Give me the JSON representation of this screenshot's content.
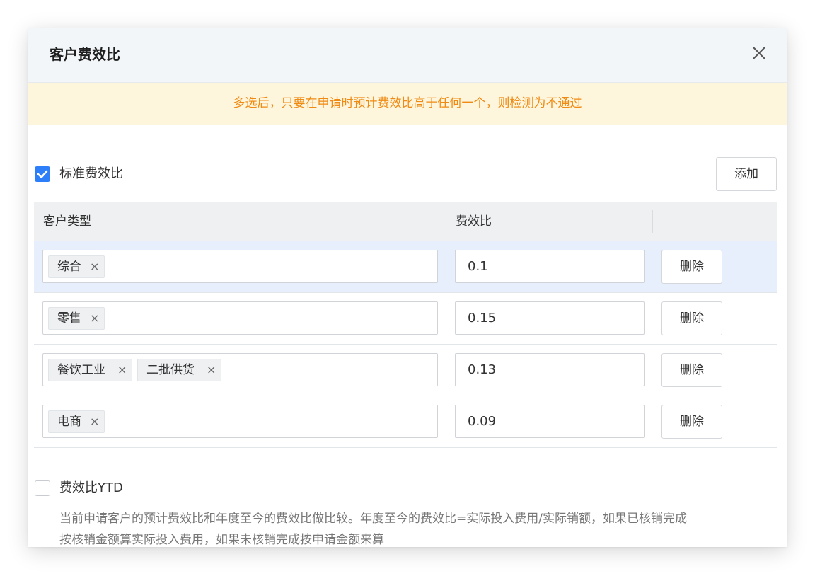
{
  "dialog": {
    "title": "客户费效比",
    "notice": "多选后，只要在申请时预计费效比高于任何一个，则检测为不通过"
  },
  "standard": {
    "checked": true,
    "label": "标准费效比",
    "add_label": "添加",
    "columns": [
      "客户类型",
      "费效比",
      ""
    ],
    "rows": [
      {
        "tags": [
          "综合"
        ],
        "value": "0.1",
        "delete_label": "删除",
        "highlighted": true
      },
      {
        "tags": [
          "零售"
        ],
        "value": "0.15",
        "delete_label": "删除"
      },
      {
        "tags": [
          "餐饮工业",
          "二批供货"
        ],
        "value": "0.13",
        "delete_label": "删除"
      },
      {
        "tags": [
          "电商"
        ],
        "value": "0.09",
        "delete_label": "删除"
      }
    ]
  },
  "ytd": {
    "checked": false,
    "label": "费效比YTD",
    "description_line1": "当前申请客户的预计费效比和年度至今的费效比做比较。年度至今的费效比=实际投入费用/实际销额，如果已核销完成",
    "description_line2": "按核销金额算实际投入费用，如果未核销完成按申请金额来算"
  },
  "icons": {
    "close": "close-icon",
    "check": "checkmark-icon",
    "tag_remove": "×"
  },
  "colors": {
    "accent": "#2d7ff9",
    "notice_text": "#f08a12",
    "notice_bg": "#fdf5dc",
    "row_highlight": "#e6effb"
  }
}
